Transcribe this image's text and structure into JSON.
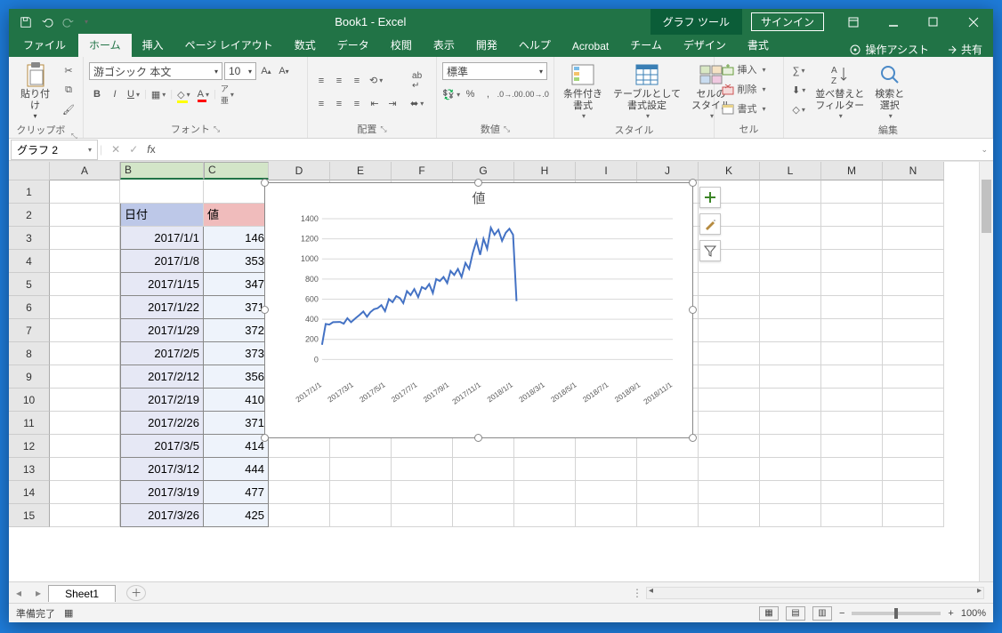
{
  "title": "Book1 - Excel",
  "contextual_tab_group": "グラフ ツール",
  "signin": "サインイン",
  "tabs": {
    "file": "ファイル",
    "home": "ホーム",
    "insert": "挿入",
    "layout": "ページ レイアウト",
    "formulas": "数式",
    "data": "データ",
    "review": "校閲",
    "view": "表示",
    "developer": "開発",
    "help": "ヘルプ",
    "acrobat": "Acrobat",
    "team": "チーム",
    "design": "デザイン",
    "format": "書式"
  },
  "tell_me": "操作アシスト",
  "share": "共有",
  "ribbon": {
    "clipboard": {
      "paste": "貼り付け",
      "label": "クリップボード"
    },
    "font": {
      "name": "游ゴシック 本文",
      "size": "10",
      "label": "フォント"
    },
    "align": {
      "wrap": "ab",
      "merge": "",
      "label": "配置"
    },
    "number": {
      "format": "標準",
      "label": "数値"
    },
    "styles": {
      "cond": "条件付き\n書式",
      "table": "テーブルとして\n書式設定",
      "cell": "セルの\nスタイル",
      "label": "スタイル"
    },
    "cells": {
      "insert": "挿入",
      "delete": "削除",
      "format": "書式",
      "label": "セル"
    },
    "editing": {
      "sort": "並べ替えと\nフィルター",
      "find": "検索と\n選択",
      "label": "編集"
    }
  },
  "namebox": "グラフ 2",
  "columns": [
    "A",
    "B",
    "C",
    "D",
    "E",
    "F",
    "G",
    "H",
    "I",
    "J",
    "K",
    "L",
    "M",
    "N"
  ],
  "rows": [
    "1",
    "2",
    "3",
    "4",
    "5",
    "6",
    "7",
    "8",
    "9",
    "10",
    "11",
    "12",
    "13",
    "14",
    "15"
  ],
  "data_headers": {
    "date": "日付",
    "value": "値"
  },
  "data": [
    {
      "d": "2017/1/1",
      "v": 146
    },
    {
      "d": "2017/1/8",
      "v": 353
    },
    {
      "d": "2017/1/15",
      "v": 347
    },
    {
      "d": "2017/1/22",
      "v": 371
    },
    {
      "d": "2017/1/29",
      "v": 372
    },
    {
      "d": "2017/2/5",
      "v": 373
    },
    {
      "d": "2017/2/12",
      "v": 356
    },
    {
      "d": "2017/2/19",
      "v": 410
    },
    {
      "d": "2017/2/26",
      "v": 371
    },
    {
      "d": "2017/3/5",
      "v": 414
    },
    {
      "d": "2017/3/12",
      "v": 444
    },
    {
      "d": "2017/3/19",
      "v": 477
    },
    {
      "d": "2017/3/26",
      "v": 425
    }
  ],
  "sheet": "Sheet1",
  "status": "準備完了",
  "zoom": "100%",
  "chart_data": {
    "type": "line",
    "title": "値",
    "ylim": [
      0,
      1400
    ],
    "yticks": [
      0,
      200,
      400,
      600,
      800,
      1000,
      1200,
      1400
    ],
    "xticks": [
      "2017/1/1",
      "2017/3/1",
      "2017/5/1",
      "2017/7/1",
      "2017/9/1",
      "2017/11/1",
      "2018/1/1",
      "2018/3/1",
      "2018/5/1",
      "2018/7/1",
      "2018/9/1",
      "2018/11/1"
    ],
    "x": [
      "2017/1/1",
      "2017/1/8",
      "2017/1/15",
      "2017/1/22",
      "2017/1/29",
      "2017/2/5",
      "2017/2/12",
      "2017/2/19",
      "2017/2/26",
      "2017/3/5",
      "2017/3/12",
      "2017/3/19",
      "2017/3/26",
      "2017/4/2",
      "2017/4/9",
      "2017/4/16",
      "2017/4/23",
      "2017/4/30",
      "2017/5/7",
      "2017/5/14",
      "2017/5/21",
      "2017/5/28",
      "2017/6/4",
      "2017/6/11",
      "2017/6/18",
      "2017/6/25",
      "2017/7/2",
      "2017/7/9",
      "2017/7/16",
      "2017/7/23",
      "2017/7/30",
      "2017/8/6",
      "2017/8/13",
      "2017/8/20",
      "2017/8/27",
      "2017/9/3",
      "2017/9/10",
      "2017/9/17",
      "2017/9/24",
      "2017/10/1",
      "2017/10/8",
      "2017/10/15",
      "2017/10/22",
      "2017/10/29",
      "2017/11/5",
      "2017/11/12",
      "2017/11/19",
      "2017/11/26",
      "2017/12/3",
      "2017/12/10",
      "2017/12/17",
      "2017/12/24",
      "2017/12/31",
      "2018/1/7"
    ],
    "values": [
      146,
      353,
      347,
      371,
      372,
      373,
      356,
      410,
      371,
      414,
      444,
      477,
      425,
      470,
      500,
      510,
      540,
      480,
      600,
      570,
      630,
      610,
      560,
      680,
      640,
      700,
      620,
      720,
      700,
      750,
      660,
      800,
      780,
      820,
      760,
      880,
      840,
      900,
      820,
      960,
      900,
      1060,
      1180,
      1040,
      1200,
      1100,
      1310,
      1240,
      1290,
      1180,
      1260,
      1300,
      1240,
      580
    ]
  }
}
